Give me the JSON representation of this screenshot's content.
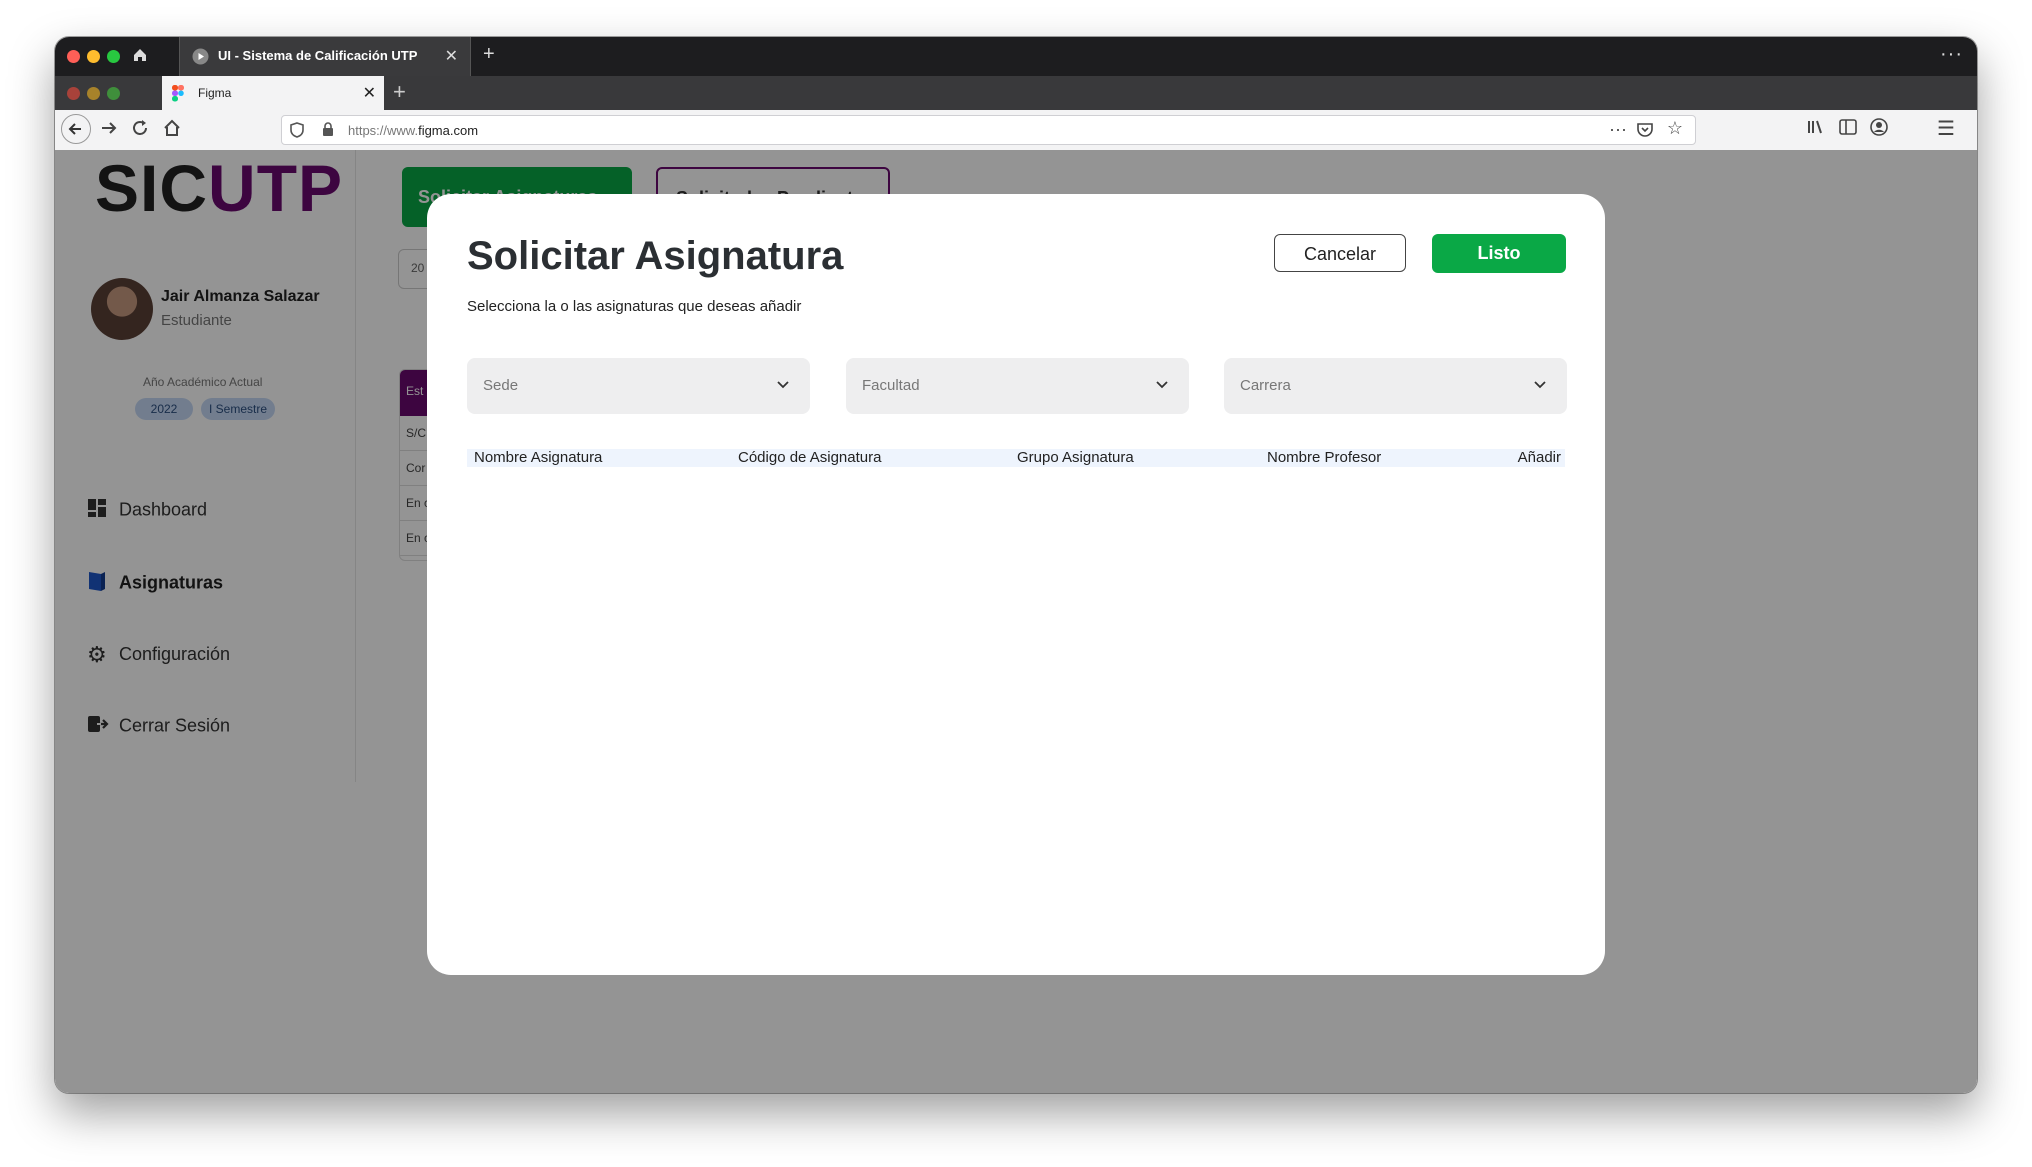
{
  "browser": {
    "outer_tab_title": "UI - Sistema de Calificación UTP",
    "inner_tab_title": "Figma",
    "url_prefix": "https://www.",
    "url_domain": "figma.com"
  },
  "sidebar": {
    "logo_part1": "SIC",
    "logo_part2": "UTP",
    "user_name": "Jair Almanza Salazar",
    "user_role": "Estudiante",
    "year_label": "Año Académico Actual",
    "year_chip": "2022",
    "semester_chip": "I Semestre",
    "nav": [
      {
        "label": "Dashboard",
        "icon": "dashboard-icon"
      },
      {
        "label": "Asignaturas",
        "icon": "book-icon"
      },
      {
        "label": "Configuración",
        "icon": "gear-icon"
      },
      {
        "label": "Cerrar Sesión",
        "icon": "logout-icon"
      }
    ]
  },
  "background": {
    "table_header": "Est",
    "table_rows": [
      "S/C",
      "Cor",
      "En c",
      "En c"
    ],
    "input_text": "20",
    "green_button_text": "Solicitar Asignaturas",
    "outline_button_text": "Solicitudes Pendientes"
  },
  "modal": {
    "title": "Solicitar Asignatura",
    "subtitle": "Selecciona la o las asignaturas que deseas añadir",
    "cancel_label": "Cancelar",
    "done_label": "Listo",
    "selects": [
      {
        "placeholder": "Sede"
      },
      {
        "placeholder": "Facultad"
      },
      {
        "placeholder": "Carrera"
      }
    ],
    "columns": [
      "Nombre Asignatura",
      "Código de Asignatura",
      "Grupo Asignatura",
      "Nombre Profesor",
      "Añadir"
    ]
  },
  "colors": {
    "accent_green": "#0aa846",
    "brand_purple": "#6a0a6e",
    "table_header_bg": "#eef4fd"
  }
}
